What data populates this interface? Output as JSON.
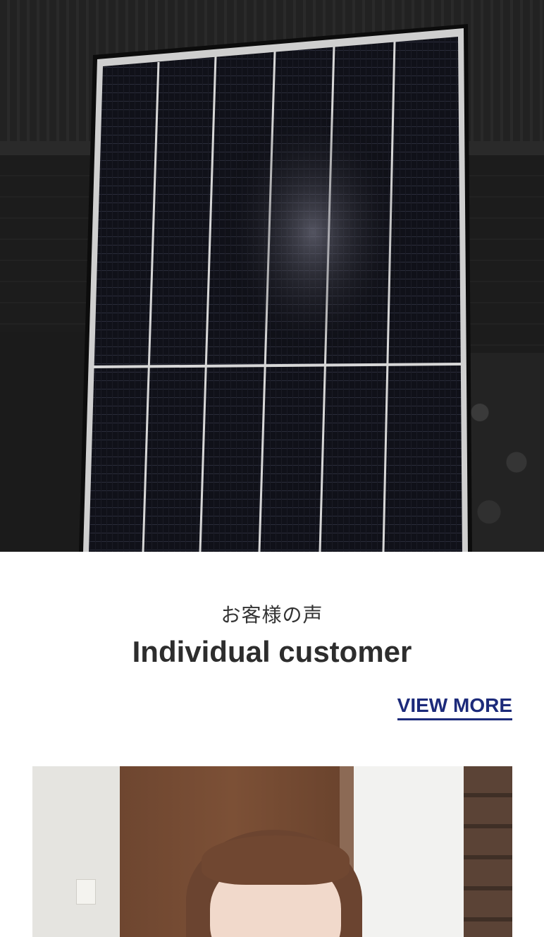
{
  "hero": {
    "image_alt_icon": "solar-panel-image"
  },
  "section": {
    "subtitle": "お客様の声",
    "title": "Individual customer",
    "view_more_label": "VIEW MORE"
  },
  "customer_photo": {
    "icon": "customer-portrait-image"
  },
  "colors": {
    "link": "#1c2a7a",
    "heading": "#2d2d2d",
    "panel": "#0f1016",
    "panel_frame": "#d9d9d9"
  }
}
